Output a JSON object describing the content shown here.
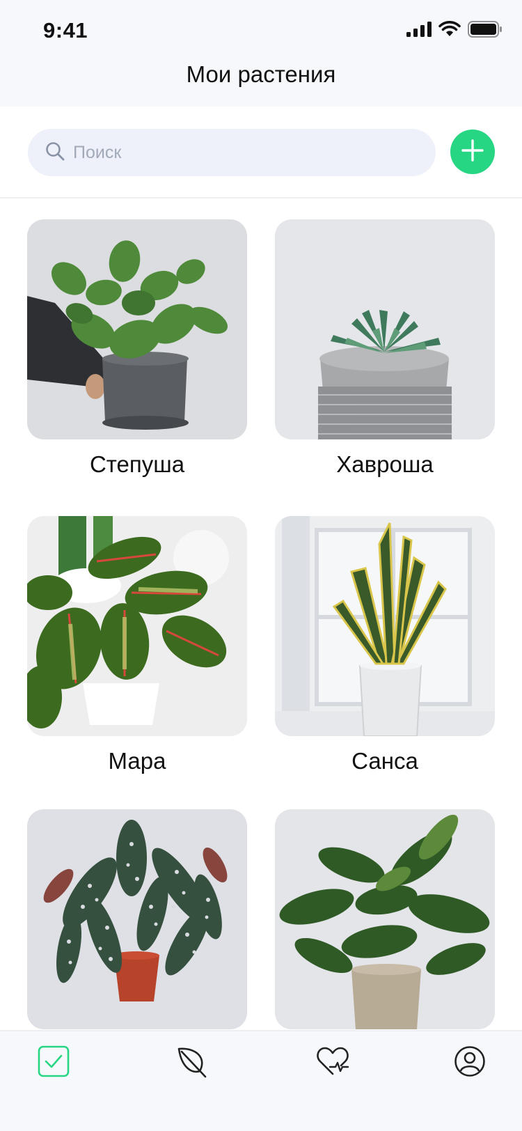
{
  "status": {
    "time": "9:41"
  },
  "header": {
    "title": "Мои растения"
  },
  "search": {
    "placeholder": "Поиск",
    "value": ""
  },
  "plants": [
    {
      "name": "Степуша"
    },
    {
      "name": "Хавроша"
    },
    {
      "name": "Мара"
    },
    {
      "name": "Санса"
    },
    {
      "name": ""
    },
    {
      "name": ""
    }
  ],
  "tabbar": {
    "tabs": [
      {
        "icon": "checkbox-icon",
        "active": true
      },
      {
        "icon": "leaf-icon",
        "active": false
      },
      {
        "icon": "heart-pulse-icon",
        "active": false
      },
      {
        "icon": "profile-icon",
        "active": false
      }
    ]
  },
  "colors": {
    "accent": "#27d683",
    "search_bg": "#eef1f9",
    "header_bg": "#f7f8fb",
    "placeholder": "#a2a9b8"
  }
}
